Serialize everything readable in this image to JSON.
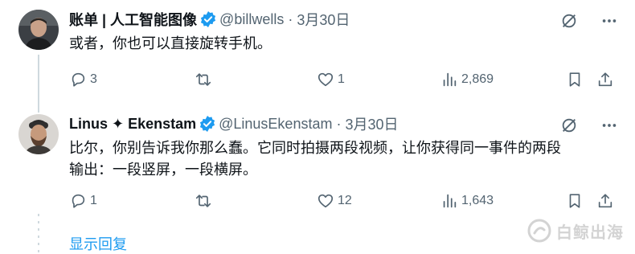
{
  "tweets": [
    {
      "name": "账单 | 人工智能图像",
      "handle": "@billwells",
      "separator": "·",
      "date": "3月30日",
      "text": "或者，你也可以直接旋转手机。",
      "replies": "3",
      "retweets": "",
      "likes": "1",
      "views": "2,869"
    },
    {
      "name": "Linus ✦ Ekenstam",
      "handle": "@LinusEkenstam",
      "separator": "·",
      "date": "3月30日",
      "text_line1": "比尔，你别告诉我你那么蠢。它同时拍摄两段视频，让你获得同一事件的两段",
      "text_line2": "输出：一段竖屏，一段横屏。",
      "replies": "1",
      "retweets": "",
      "likes": "12",
      "views": "1,643"
    }
  ],
  "show_replies": "显示回复",
  "watermark": "白鲸出海",
  "colors": {
    "accent": "#1d9bf0",
    "muted": "#536471",
    "line": "#cfd9de"
  },
  "icons": [
    "reply-icon",
    "retweet-icon",
    "like-icon",
    "views-icon",
    "bookmark-icon",
    "share-icon",
    "grok-icon",
    "more-icon",
    "verified-icon"
  ]
}
